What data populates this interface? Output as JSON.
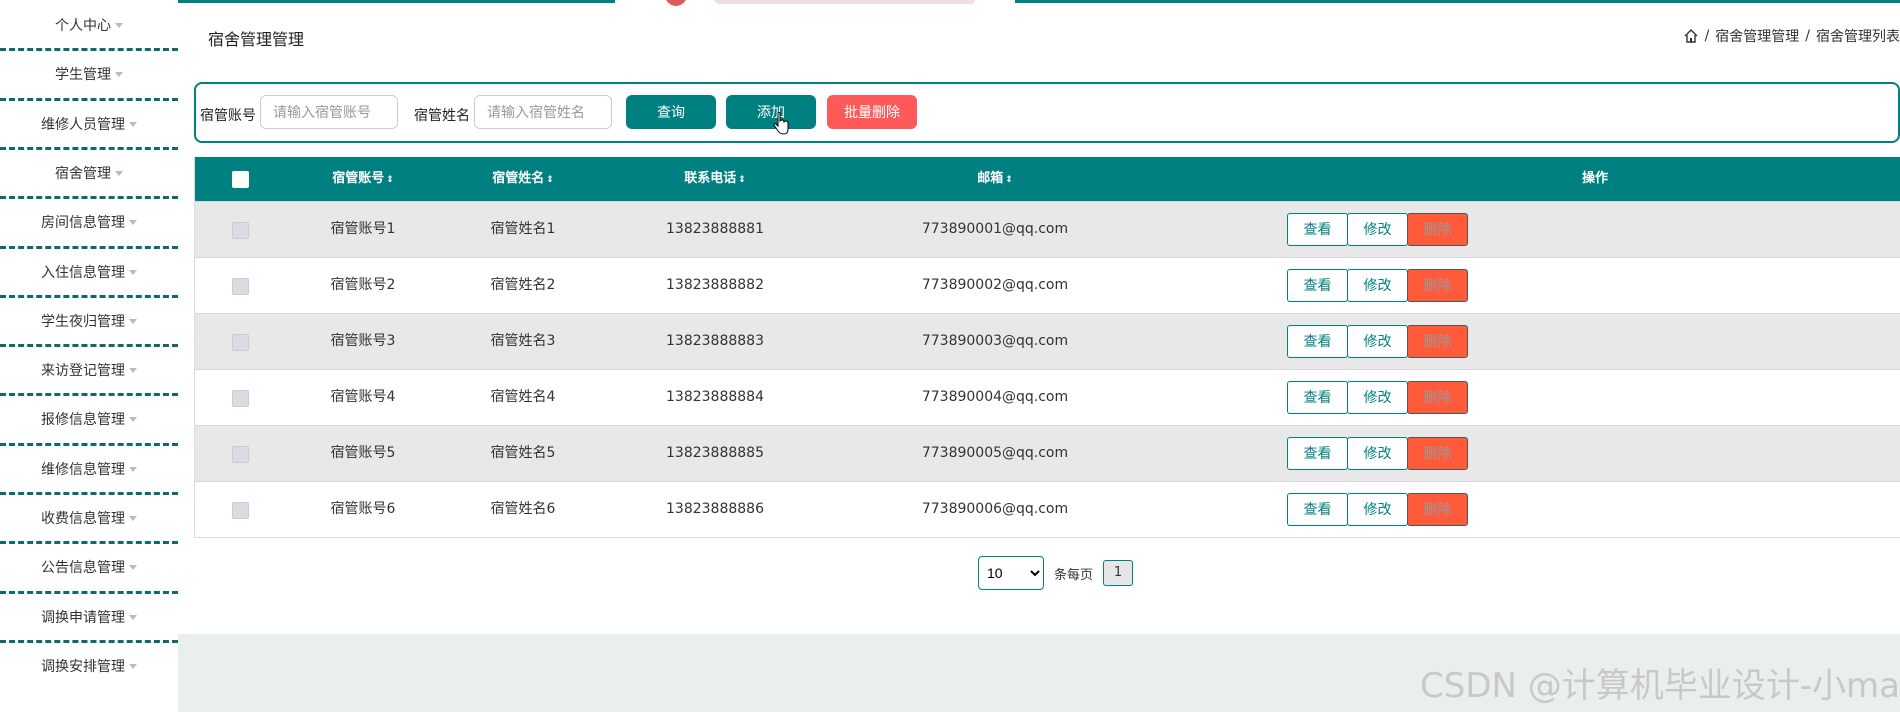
{
  "sidebar": {
    "items": [
      {
        "label": "个人中心"
      },
      {
        "label": "学生管理"
      },
      {
        "label": "维修人员管理"
      },
      {
        "label": "宿舍管理"
      },
      {
        "label": "房间信息管理"
      },
      {
        "label": "入住信息管理"
      },
      {
        "label": "学生夜归管理"
      },
      {
        "label": "来访登记管理"
      },
      {
        "label": "报修信息管理"
      },
      {
        "label": "维修信息管理"
      },
      {
        "label": "收费信息管理"
      },
      {
        "label": "公告信息管理"
      },
      {
        "label": "调换申请管理"
      },
      {
        "label": "调换安排管理"
      }
    ]
  },
  "header": {
    "title": "宿舍管理管理",
    "breadcrumb": [
      "宿舍管理管理",
      "宿舍管理列表"
    ],
    "breadcrumb_sep": "/"
  },
  "search": {
    "account_label": "宿管账号",
    "account_placeholder": "请输入宿管账号",
    "name_label": "宿管姓名",
    "name_placeholder": "请输入宿管姓名",
    "query_button": "查询",
    "add_button": "添加",
    "batch_delete_button": "批量删除"
  },
  "table": {
    "headers": {
      "account": "宿管账号",
      "name": "宿管姓名",
      "phone": "联系电话",
      "email": "邮箱",
      "actions": "操作"
    },
    "sort_icon": "⇕",
    "rows": [
      {
        "account": "宿管账号1",
        "name": "宿管姓名1",
        "phone": "13823888881",
        "email": "773890001@qq.com"
      },
      {
        "account": "宿管账号2",
        "name": "宿管姓名2",
        "phone": "13823888882",
        "email": "773890002@qq.com"
      },
      {
        "account": "宿管账号3",
        "name": "宿管姓名3",
        "phone": "13823888883",
        "email": "773890003@qq.com"
      },
      {
        "account": "宿管账号4",
        "name": "宿管姓名4",
        "phone": "13823888884",
        "email": "773890004@qq.com"
      },
      {
        "account": "宿管账号5",
        "name": "宿管姓名5",
        "phone": "13823888885",
        "email": "773890005@qq.com"
      },
      {
        "account": "宿管账号6",
        "name": "宿管姓名6",
        "phone": "13823888886",
        "email": "773890006@qq.com"
      }
    ],
    "actions": {
      "view": "查看",
      "edit": "修改",
      "delete": "删除"
    }
  },
  "pagination": {
    "page_size": "10",
    "per_page_label": "条每页",
    "current_page": "1"
  },
  "watermark": "CSDN @计算机毕业设计-小ma",
  "colors": {
    "accent": "#008080",
    "danger": "#ff5a5a",
    "sidebar_separator": "#0e6b6b"
  },
  "icons": [
    "home-icon",
    "caret-down-icon",
    "sort-icon",
    "cursor-icon"
  ]
}
